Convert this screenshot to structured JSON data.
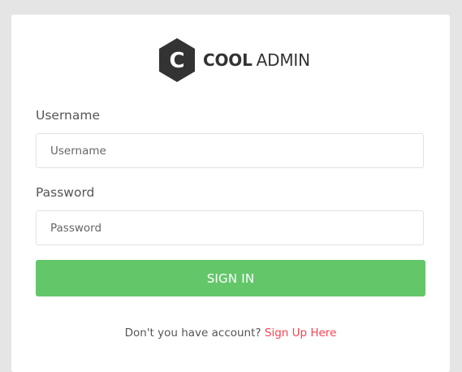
{
  "logo": {
    "icon_letter": "C",
    "brand_bold": "COOL",
    "brand_light": "ADMIN",
    "icon": "hexagon-c-logo"
  },
  "form": {
    "username_label": "Username",
    "username_placeholder": "Username",
    "username_value": "",
    "password_label": "Password",
    "password_placeholder": "Password",
    "password_value": "",
    "signin_label": "SIGN IN"
  },
  "register": {
    "prompt": "Don't you have account?",
    "link_label": "Sign Up Here"
  },
  "colors": {
    "background": "#e5e5e5",
    "card": "#ffffff",
    "signin_button": "#63c76a",
    "link": "#fa4251",
    "logo_hex": "#333333"
  }
}
